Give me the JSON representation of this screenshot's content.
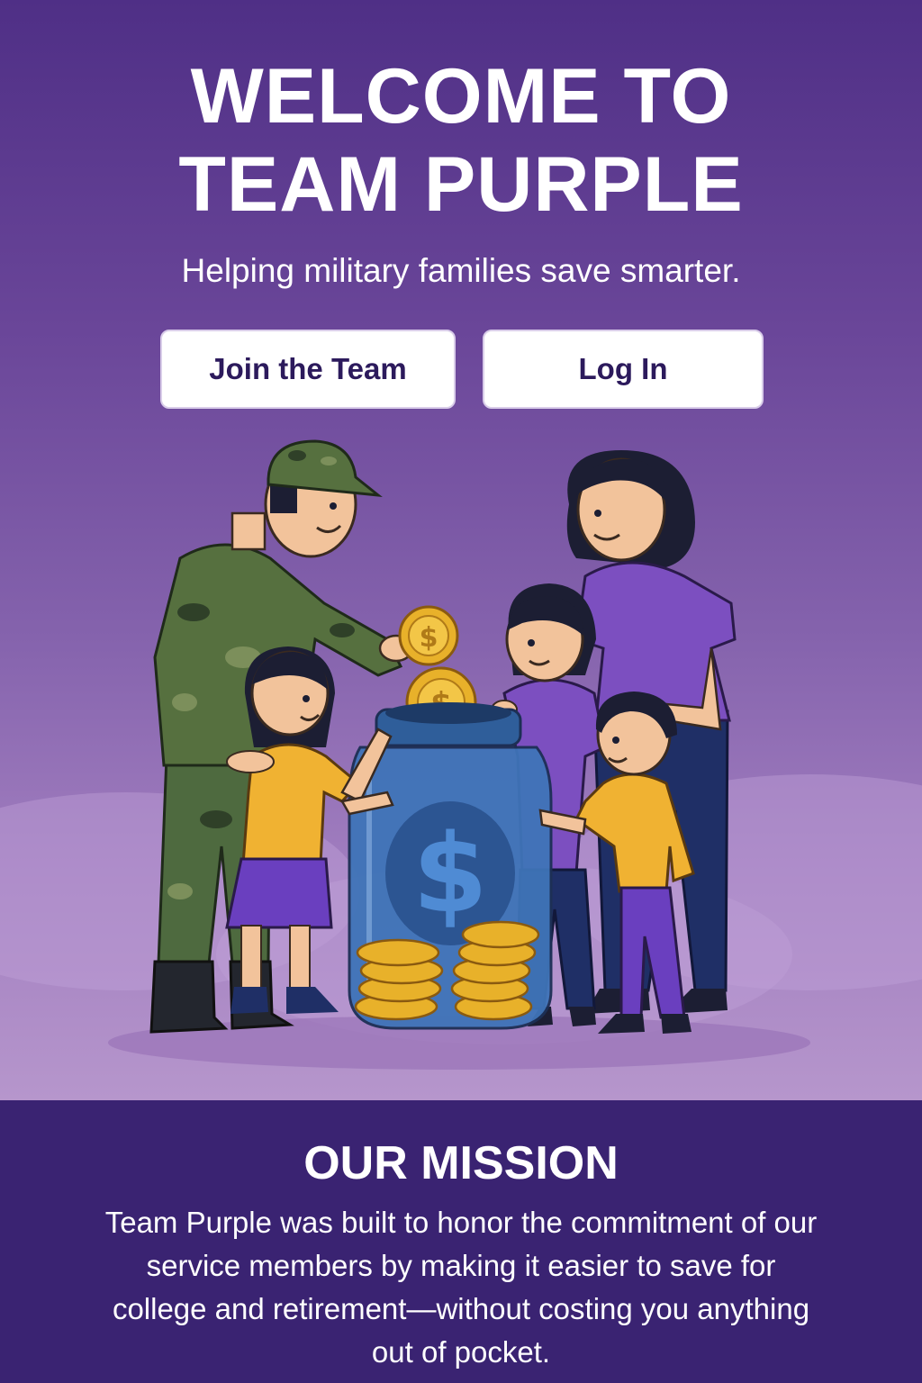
{
  "hero": {
    "title_line1": "WELCOME TO",
    "title_line2": "TEAM PURPLE",
    "subtitle": "Helping military families save smarter.",
    "buttons": {
      "join": "Join the Team",
      "login": "Log In"
    },
    "illustration": {
      "coin_symbol": "$",
      "jar_symbol": "$",
      "icons": [
        "soldier-icon",
        "mother-icon",
        "child-icon",
        "coin-icon",
        "savings-jar-icon"
      ]
    }
  },
  "mission": {
    "title": "OUR MISSION",
    "text": "Team Purple was built to honor the commitment of our service members by making it easier to save for college and retirement—without costing you anything out of pocket."
  },
  "colors": {
    "hero_top": "#4f2f86",
    "hero_bottom": "#b696cc",
    "mission_bg": "#3a2372",
    "button_text": "#2c1a5c",
    "coin_gold": "#e8b12a",
    "jar_blue": "#3f74b8"
  }
}
